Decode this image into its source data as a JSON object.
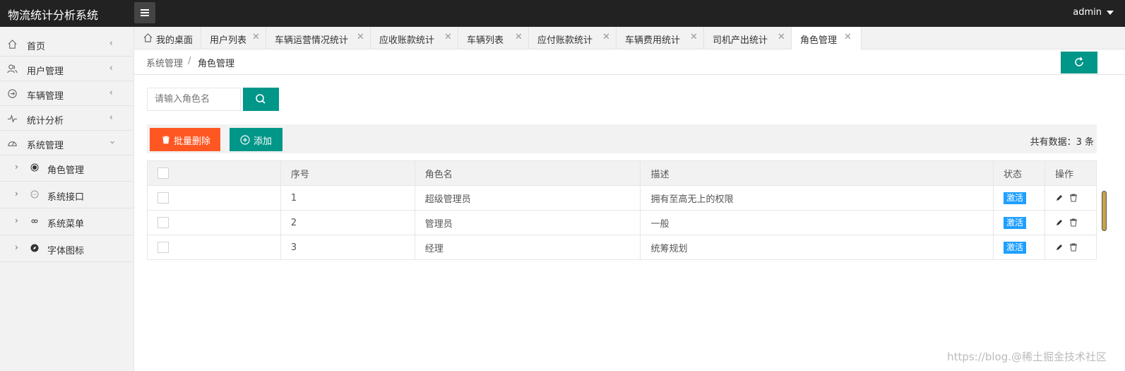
{
  "app": {
    "title": "物流统计分析系统",
    "user": "admin"
  },
  "sidebar": {
    "items": [
      {
        "label": "首页",
        "icon": "home-icon"
      },
      {
        "label": "用户管理",
        "icon": "users-icon"
      },
      {
        "label": "车辆管理",
        "icon": "vehicle-icon"
      },
      {
        "label": "统计分析",
        "icon": "pulse-icon"
      },
      {
        "label": "系统管理",
        "icon": "dashboard-icon"
      }
    ],
    "sub_items": [
      {
        "label": "角色管理",
        "icon": "record-icon"
      },
      {
        "label": "系统接口",
        "icon": "interface-icon"
      },
      {
        "label": "系统菜单",
        "icon": "link-icon"
      },
      {
        "label": "字体图标",
        "icon": "compass-icon"
      }
    ]
  },
  "tabs": [
    {
      "label": "我的桌面"
    },
    {
      "label": "用户列表"
    },
    {
      "label": "车辆运营情况统计"
    },
    {
      "label": "应收账款统计"
    },
    {
      "label": "车辆列表"
    },
    {
      "label": "应付账款统计"
    },
    {
      "label": "车辆费用统计"
    },
    {
      "label": "司机产出统计"
    },
    {
      "label": "角色管理"
    }
  ],
  "tab_close": "✕",
  "breadcrumb": {
    "parent": "系统管理",
    "separator": "/",
    "current": "角色管理"
  },
  "search": {
    "placeholder": "请输入角色名"
  },
  "toolbar": {
    "delete_label": "批量删除",
    "add_label": "添加",
    "total": "共有数据：3 条"
  },
  "table": {
    "headers": [
      "序号",
      "角色名",
      "描述",
      "状态",
      "操作"
    ],
    "rows": [
      {
        "id": "1",
        "name": "超级管理员",
        "desc": "拥有至高无上的权限",
        "status": "激活"
      },
      {
        "id": "2",
        "name": "管理员",
        "desc": "一般",
        "status": "激活"
      },
      {
        "id": "3",
        "name": "经理",
        "desc": "统筹规划",
        "status": "激活"
      }
    ]
  },
  "watermark": "https://blog.@稀土掘金技术社区",
  "colors": {
    "primary": "#009688",
    "danger": "#ff5722",
    "badge": "#1e9fff",
    "topbar": "#222222"
  }
}
